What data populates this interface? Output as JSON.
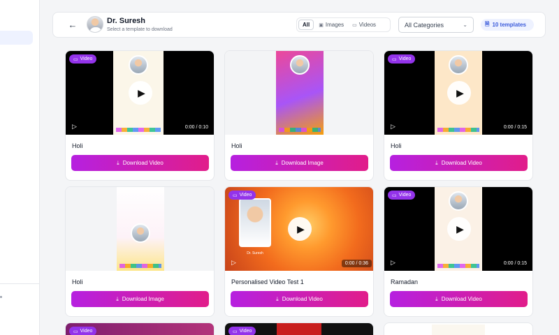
{
  "header": {
    "title": "Dr. Suresh",
    "subtitle": "Select a template to download",
    "filters": [
      "All",
      "Images",
      "Videos"
    ],
    "active_filter": "All",
    "category": "All Categories",
    "template_count": "10 templates"
  },
  "cards": [
    {
      "badge": "Video",
      "title": "Holi",
      "button": "Download Video",
      "time": "0:00 / 0:10"
    },
    {
      "badge": "",
      "title": "Holi",
      "button": "Download Image",
      "time": ""
    },
    {
      "badge": "Video",
      "title": "Holi",
      "button": "Download Video",
      "time": "0:00 / 0:15"
    },
    {
      "badge": "",
      "title": "Holi",
      "button": "Download Image",
      "time": ""
    },
    {
      "badge": "Video",
      "title": "Personalised Video Test 1",
      "button": "Download Video",
      "time": "0:00 / 0:36",
      "poster_name": "Dr. Suresh"
    },
    {
      "badge": "Video",
      "title": "Ramadan",
      "button": "Download Video",
      "time": "0:00 / 0:15"
    }
  ],
  "partial_badges": [
    "Video",
    "Video"
  ],
  "colors": {
    "accent_start": "#b620e0",
    "accent_end": "#e11d8a",
    "badge": "#9333ea"
  }
}
